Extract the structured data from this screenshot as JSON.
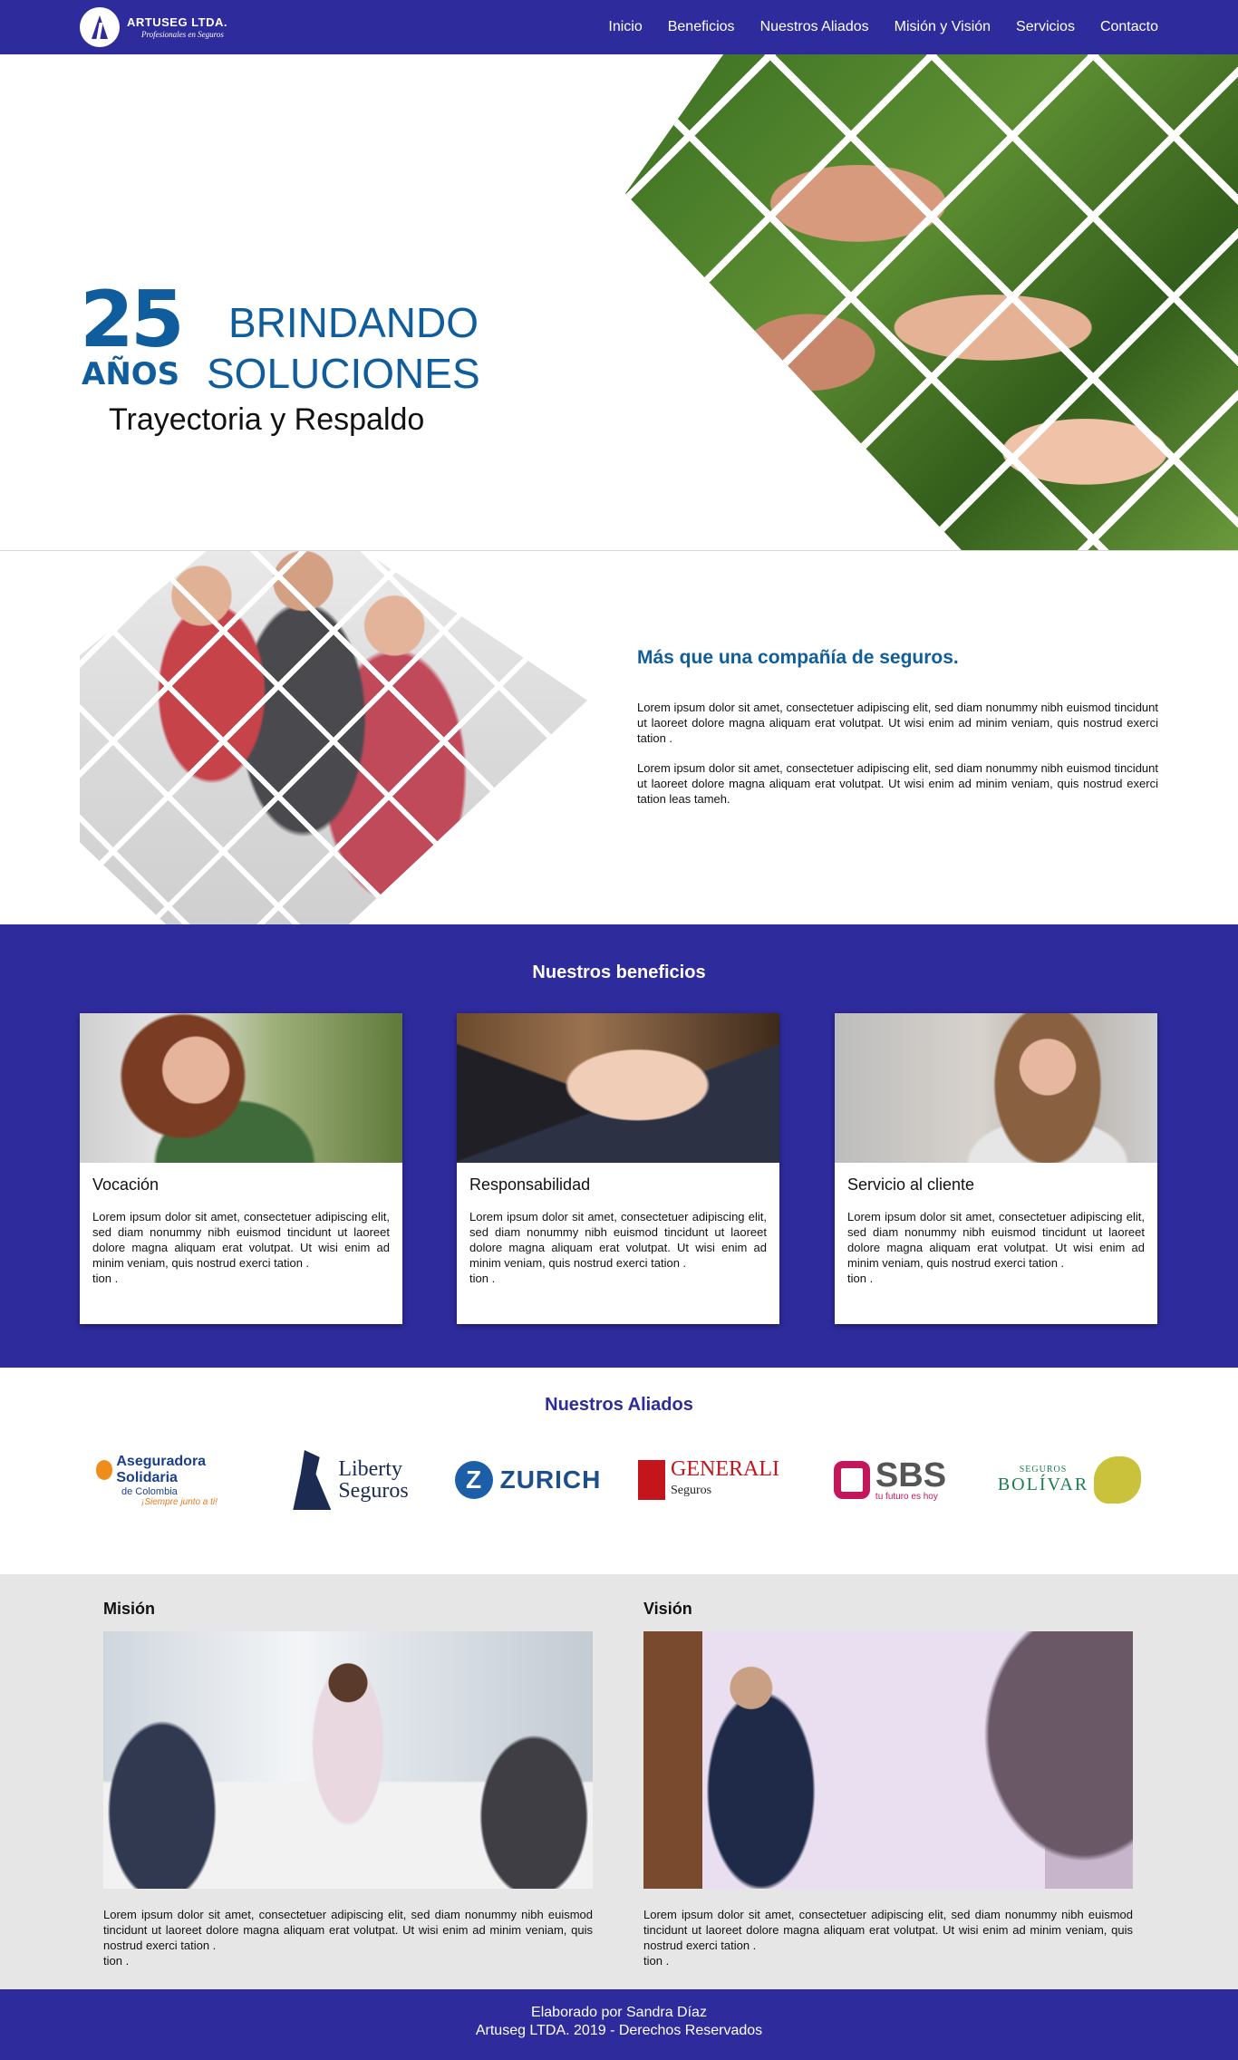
{
  "brand": {
    "name": "ARTUSEG LTDA.",
    "tagline": "Profesionales en Seguros",
    "primary_color": "#2e2b9c",
    "accent_color": "#0f5d9c"
  },
  "nav": {
    "items": [
      {
        "label": "Inicio"
      },
      {
        "label": "Beneficios"
      },
      {
        "label": "Nuestros Aliados"
      },
      {
        "label": "Misión y Visión"
      },
      {
        "label": "Servicios"
      },
      {
        "label": "Contacto"
      }
    ]
  },
  "hero": {
    "years_number": "25",
    "years_label": "AÑOS",
    "headline_line1": "BRINDANDO",
    "headline_line2": "SOLUCIONES",
    "subtitle": "Trayectoria y Respaldo"
  },
  "about": {
    "title": "Más que una compañía de seguros.",
    "paragraphs": [
      "Lorem ipsum dolor sit amet, consectetuer adipiscing elit, sed diam nonummy nibh euismod tincidunt ut laoreet dolore magna aliquam erat volutpat. Ut wisi enim ad minim veniam, quis nostrud exerci tation .",
      "Lorem ipsum dolor sit amet, consectetuer adipiscing elit, sed diam nonummy nibh euismod tincidunt ut laoreet dolore magna aliquam erat volutpat. Ut wisi enim ad minim veniam, quis nostrud exerci tation  leas tameh."
    ]
  },
  "benefits": {
    "title": "Nuestros beneficios",
    "cards": [
      {
        "title": "Vocación",
        "text": "Lorem ipsum dolor sit amet, consectetuer adipiscing elit, sed diam nonummy nibh euismod tincidunt ut laoreet dolore magna aliquam erat volutpat. Ut wisi enim ad minim veniam, quis nostrud exerci tation .",
        "text2": "tion ."
      },
      {
        "title": "Responsabilidad",
        "text": "Lorem ipsum dolor sit amet, consectetuer adipiscing elit, sed diam nonummy nibh euismod tincidunt ut laoreet dolore magna aliquam erat volutpat. Ut wisi enim ad minim veniam, quis nostrud exerci tation .",
        "text2": "tion ."
      },
      {
        "title": "Servicio al cliente",
        "text": "Lorem ipsum dolor sit amet, consectetuer adipiscing elit, sed diam nonummy nibh euismod tincidunt ut laoreet dolore magna aliquam erat volutpat. Ut wisi enim ad minim veniam, quis nostrud exerci tation .",
        "text2": "tion ."
      }
    ]
  },
  "allies": {
    "title": "Nuestros Aliados",
    "aseguradora": {
      "line1": "Aseguradora Solidaria",
      "line2": "de Colombia",
      "slogan": "¡Siempre junto a ti!"
    },
    "liberty": {
      "line1": "Liberty",
      "line2": "Seguros"
    },
    "zurich": {
      "mark": "Z",
      "name": "ZURICH"
    },
    "generali": {
      "name": "GENERALI",
      "sub": "Seguros"
    },
    "sbs": {
      "name": "SBS",
      "sub": "tu futuro es hoy"
    },
    "bolivar": {
      "small": "SEGUROS",
      "name": "BOLÍVAR"
    }
  },
  "mission": {
    "title": "Misión",
    "text": "Lorem ipsum dolor sit amet, consectetuer adipiscing elit, sed diam nonummy nibh euismod tincidunt ut laoreet dolore magna aliquam erat volutpat. Ut wisi enim ad minim veniam, quis nostrud exerci tation .",
    "text2": "tion ."
  },
  "vision": {
    "title": "Visión",
    "text": "Lorem ipsum dolor sit amet, consectetuer adipiscing elit, sed diam nonummy nibh euismod tincidunt ut laoreet dolore magna aliquam erat volutpat. Ut wisi enim ad minim veniam, quis nostrud exerci tation .",
    "text2": "tion ."
  },
  "footer": {
    "line1": "Elaborado por Sandra Díaz",
    "line2": "Artuseg LTDA. 2019 - Derechos Reservados"
  }
}
